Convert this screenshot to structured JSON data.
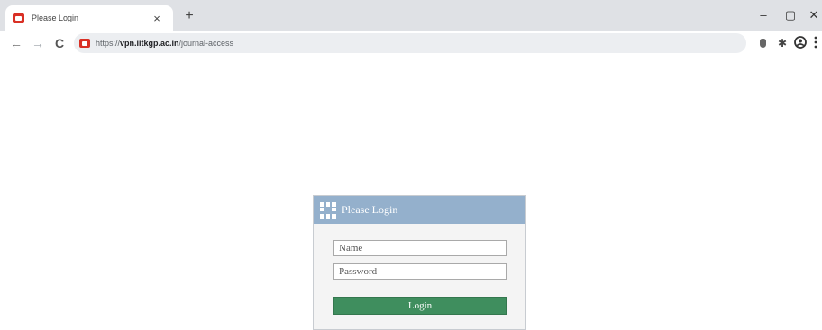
{
  "browser": {
    "tab": {
      "title": "Please Login",
      "close_glyph": "×"
    },
    "new_tab_glyph": "+",
    "window_controls": {
      "minimize": "–",
      "restore": "▢",
      "close": "✕"
    },
    "nav": {
      "back": "←",
      "forward": "→",
      "reload": "C"
    },
    "address": {
      "scheme": "https://",
      "host": "vpn.iitkgp.ac.in",
      "path": "/journal-access"
    },
    "extensions": [
      "shield-icon",
      "puzzle-icon",
      "profile-icon",
      "menu-icon"
    ]
  },
  "login": {
    "header_icon": "grid-icon",
    "title": "Please Login",
    "name_placeholder": "Name",
    "password_placeholder": "Password",
    "button_label": "Login"
  },
  "colors": {
    "tab_strip": "#dfe1e5",
    "panel_header": "#94b0cc",
    "login_button": "#3f8e5e",
    "favicon": "#d93025"
  }
}
